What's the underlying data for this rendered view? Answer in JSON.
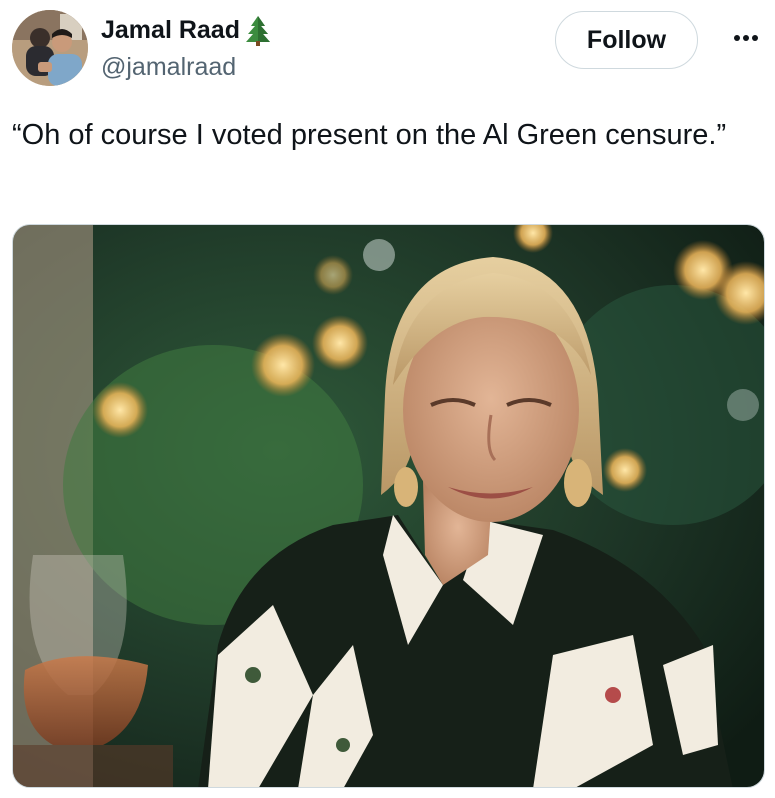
{
  "user": {
    "display_name": "Jamal Raad",
    "handle": "@jamalraad",
    "badge_icon": "evergreen-tree-icon",
    "avatar_icon": "profile-photo"
  },
  "actions": {
    "follow_label": "Follow",
    "more_icon": "more-options-icon"
  },
  "tweet": {
    "text": "“Oh of course I voted present on the Al Green censure.”"
  },
  "media": {
    "type": "photo"
  },
  "colors": {
    "text_primary": "#0f1419",
    "text_secondary": "#536471",
    "border": "#cfd9de",
    "tree_green": "#2e8b3a"
  }
}
